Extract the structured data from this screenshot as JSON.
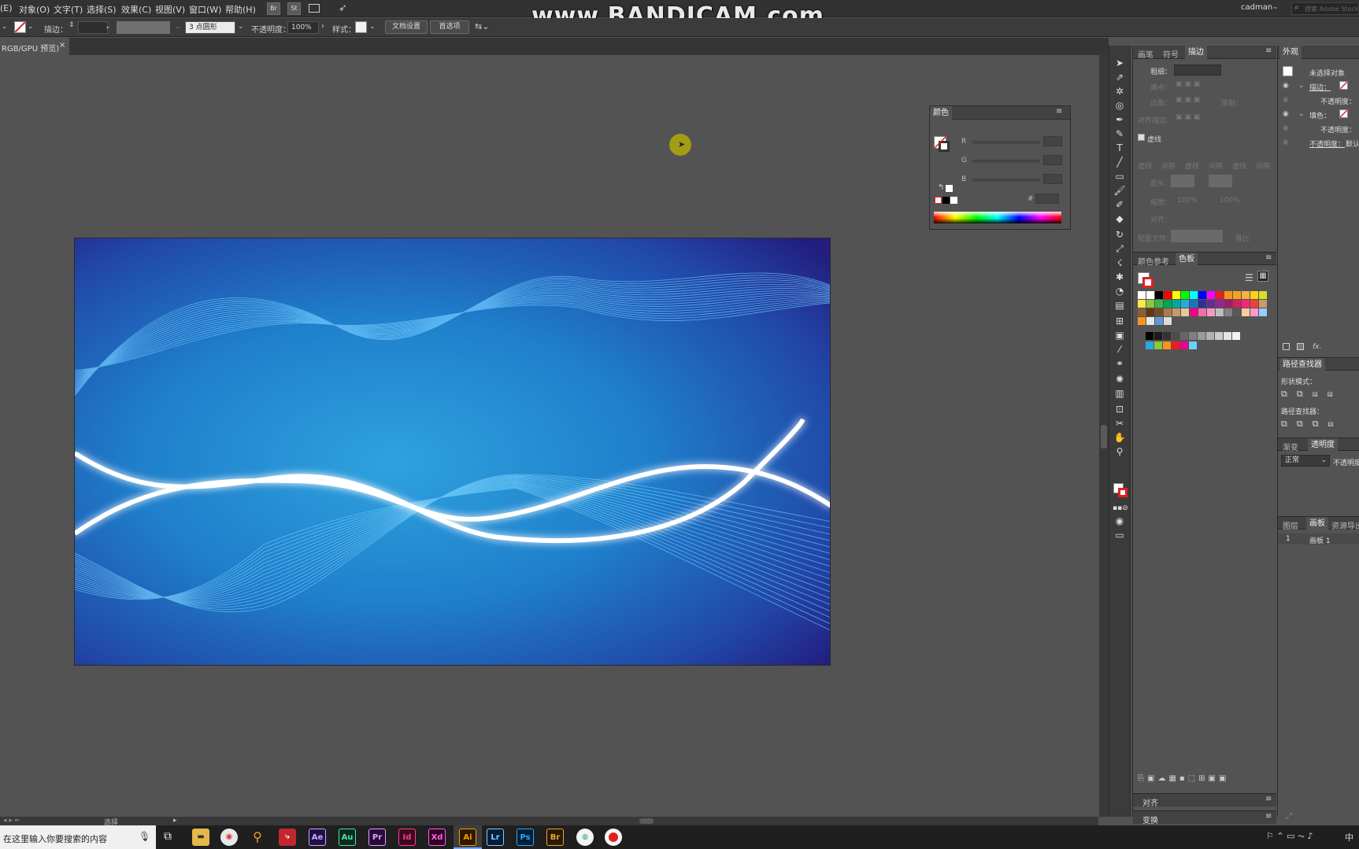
{
  "menubar": {
    "items": [
      "(E)",
      "对象(O)",
      "文字(T)",
      "选择(S)",
      "效果(C)",
      "视图(V)",
      "窗口(W)",
      "帮助(H)"
    ],
    "bridge_label": "Br",
    "stock_label": "St",
    "user": "cadman",
    "search_placeholder": "搜索 Adobe Stock"
  },
  "watermark": "www.BANDICAM.com",
  "controlbar": {
    "stroke_label": "描边：",
    "brush_label": "3 点圆形",
    "opacity_label": "不透明度：",
    "opacity_value": "100%",
    "style_label": "样式：",
    "doc_setup_button": "文档设置",
    "prefs_button": "首选项"
  },
  "document_tab": {
    "title": "RGB/GPU 预览)",
    "close": "×"
  },
  "color_panel": {
    "title": "颜色",
    "channels": [
      "R",
      "G",
      "B"
    ],
    "hex_label": "#"
  },
  "stroke_panel": {
    "tabs": [
      "画笔",
      "符号",
      "描边"
    ],
    "active_tab": "描边",
    "weight_label": "粗细：",
    "cap_label": "端点：",
    "corner_label": "边角：",
    "limit_label": "限制：",
    "align_label": "对齐描边：",
    "dashed_label": "虚线",
    "dash_fields": [
      "虚线",
      "间隙",
      "虚线",
      "间隙",
      "虚线",
      "间隙"
    ],
    "arrow_label": "箭头：",
    "scale_label": "缩放：",
    "scale_value1": "100%",
    "scale_value2": "100%",
    "align_arrow_label": "对齐：",
    "profile_label": "配置文件：",
    "profile_value": "等比"
  },
  "swatches_panel": {
    "tabs": [
      "颜色参考",
      "色板"
    ],
    "active_tab": "色板"
  },
  "appearance_panel": {
    "title": "外观",
    "no_selection": "未选择对象",
    "stroke_label": "描边：",
    "opacity_label_1": "不透明度：",
    "fill_label": "填色：",
    "opacity_label_2": "不透明度：",
    "opacity_label_3": "不透明度：",
    "opacity_value_3": "默认",
    "fx_label": "fx."
  },
  "pathfinder_panel": {
    "title": "路径查找器",
    "shape_modes_label": "形状模式：",
    "pathfinders_label": "路径查找器："
  },
  "transparency_panel": {
    "tabs": [
      "渐变",
      "透明度"
    ],
    "active_tab": "透明度",
    "blend_mode": "正常",
    "opacity_label": "不透明度"
  },
  "artboards_panel": {
    "tabs": [
      "图层",
      "画板",
      "资源导出"
    ],
    "active_tab": "画板",
    "rows": [
      {
        "index": "1",
        "name": "画板 1"
      }
    ]
  },
  "align_panel": {
    "title": "对齐"
  },
  "transform_panel": {
    "title": "变换"
  },
  "status": {
    "tool_label": "选择"
  },
  "taskbar": {
    "search_placeholder": "在这里输入你要搜索的内容",
    "apps": [
      "Ae",
      "Au",
      "Pr",
      "Id",
      "Xd",
      "Ai",
      "Lr",
      "Ps",
      "Br"
    ]
  }
}
